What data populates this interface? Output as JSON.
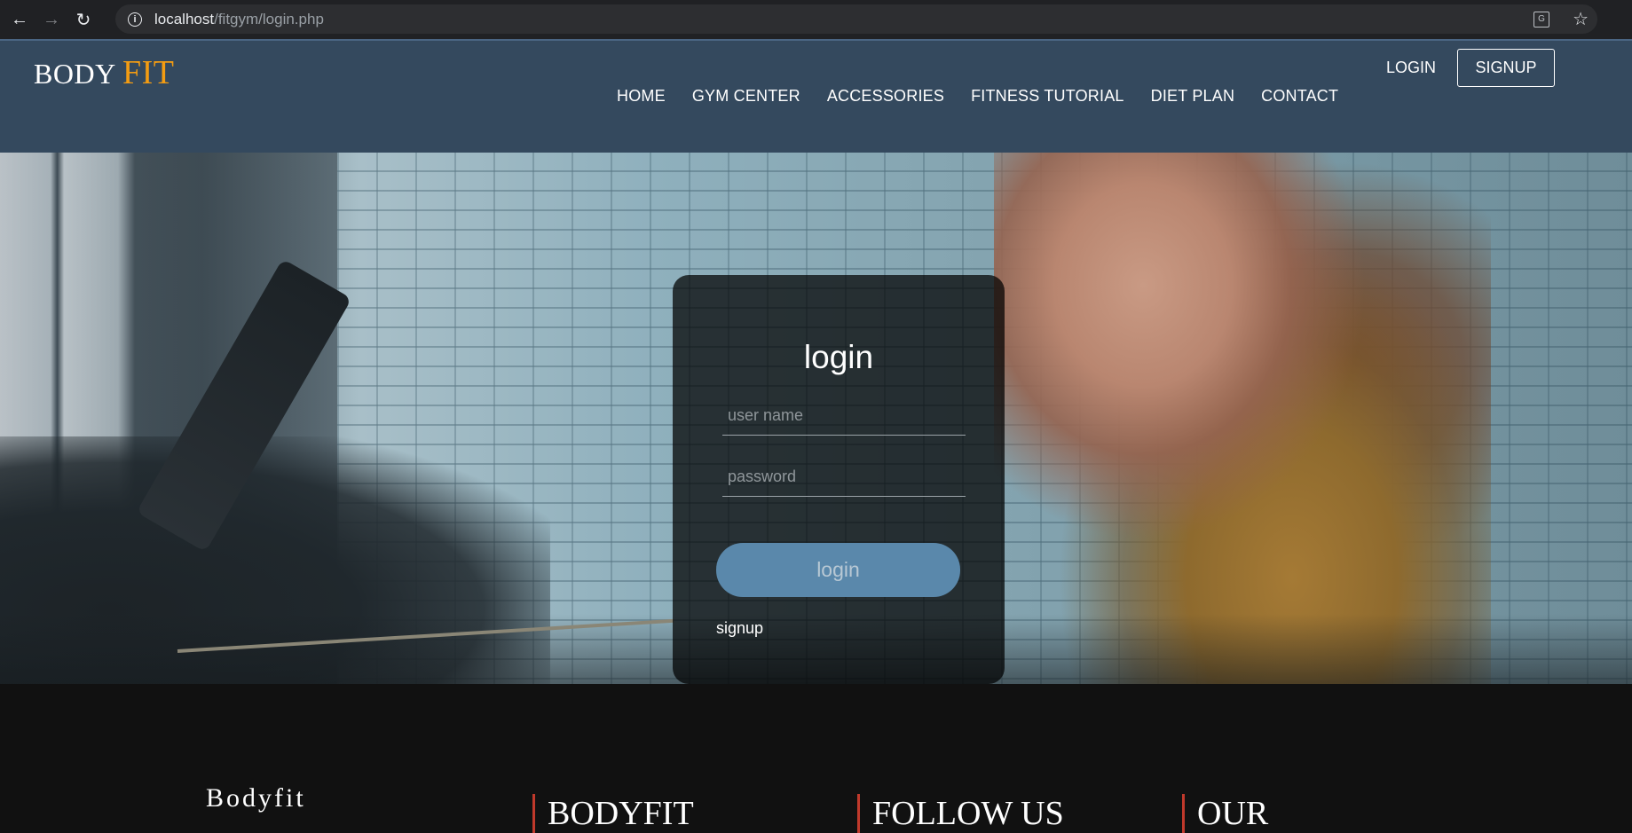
{
  "browser": {
    "url_host": "localhost",
    "url_path": "/fitgym/login.php",
    "icons": [
      "back-icon",
      "forward-icon",
      "reload-icon",
      "info-icon",
      "translate-icon",
      "star-icon"
    ]
  },
  "header": {
    "logo_main": "BODY",
    "logo_accent": "FIT",
    "nav": [
      "HOME",
      "GYM CENTER",
      "ACCESSORIES",
      "FITNESS TUTORIAL",
      "DIET PLAN",
      "CONTACT"
    ],
    "login_label": "LOGIN",
    "signup_label": "SIGNUP"
  },
  "login_form": {
    "title": "login",
    "username_placeholder": "user name",
    "password_placeholder": "password",
    "submit_label": "login",
    "signup_link": "signup"
  },
  "footer": {
    "brand": "Bodyfit",
    "col1": "BODYFIT",
    "col2": "FOLLOW US",
    "col3": "OUR"
  },
  "colors": {
    "header_bg": "#34495e",
    "accent": "#f39c12",
    "button": "#5a88ab",
    "footer_bg": "#111111",
    "footer_rule": "#c0392b"
  }
}
